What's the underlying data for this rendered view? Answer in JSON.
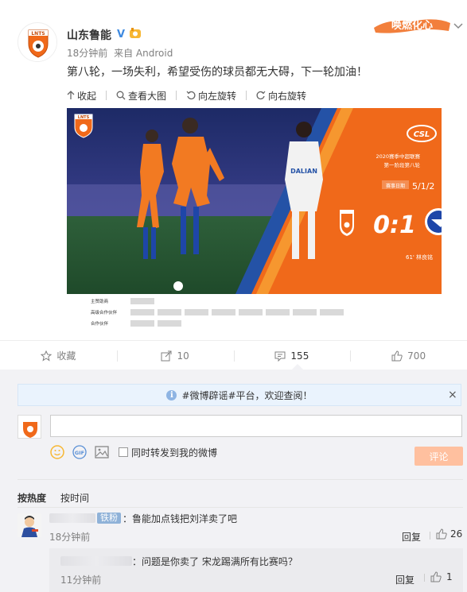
{
  "post": {
    "author": "山东鲁能",
    "time": "18分钟前",
    "source": "来自 Android",
    "content": "第八轮，一场失利，希望受伤的球员都无大碍，下一轮加油！",
    "decoration_text": "唤燃化心"
  },
  "image_toolbar": [
    {
      "label": "收起",
      "icon": "arrow-up-icon"
    },
    {
      "label": "查看大图",
      "icon": "magnifier-icon"
    },
    {
      "label": "向左旋转",
      "icon": "rotate-left-icon"
    },
    {
      "label": "向右旋转",
      "icon": "rotate-right-icon"
    }
  ],
  "match_graphic": {
    "club_badge_text": "LNTS",
    "league_logo": "CSL",
    "season_line1": "2020赛季中超联赛",
    "season_line2": "第一阶段第八轮",
    "date_label": "赛事日期",
    "date_value": "5/1/2",
    "score": "0:1",
    "scorer_line": "61' 林良铭",
    "sponsor_rows": [
      "主赞助商",
      "高级合作伙伴",
      "合作伙伴"
    ]
  },
  "actions": {
    "favorite": "收藏",
    "forward_count": "10",
    "comment_count": "155",
    "like_count": "700"
  },
  "notice": {
    "text": "#微博辟谣#平台，欢迎查阅！",
    "close": "×"
  },
  "composer": {
    "placeholder": "",
    "forward_label": "同时转发到我的微博",
    "submit": "评论"
  },
  "sort": {
    "hot": "按热度",
    "time": "按时间"
  },
  "comments": [
    {
      "badge": "铁粉",
      "text": "：鲁能加点钱把刘洋卖了吧",
      "time": "18分钟前",
      "reply": "回复",
      "likes": "26"
    }
  ],
  "sub_replies": [
    {
      "text": "：问题是你卖了 宋龙踢满所有比赛吗？",
      "time": "11分钟前",
      "reply": "回复",
      "likes": "1"
    }
  ],
  "colors": {
    "orange": "#f0691a",
    "link_blue": "#eb7350",
    "submit_disabled": "#ffc09f",
    "notice_bg": "#eaf3fd",
    "comment_bg": "#f2f2f5"
  }
}
